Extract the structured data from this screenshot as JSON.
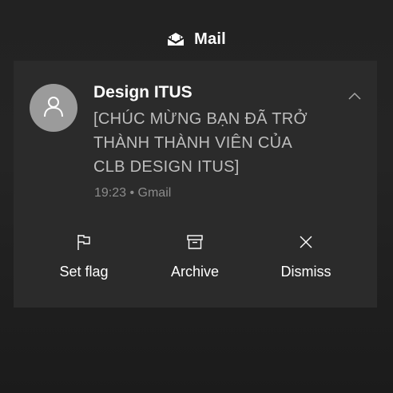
{
  "app": {
    "name": "Mail",
    "icon": "mail-envelope-icon"
  },
  "notification": {
    "sender": "Design ITUS",
    "subject_lines": [
      "[CHÚC MỪNG BẠN ĐÃ TRỞ",
      "THÀNH THÀNH VIÊN CỦA",
      "CLB DESIGN ITUS]"
    ],
    "meta": "19:23 • Gmail",
    "avatar_icon": "person-icon",
    "collapse_icon": "chevron-up-icon"
  },
  "actions": [
    {
      "label": "Set flag",
      "icon": "flag-icon"
    },
    {
      "label": "Archive",
      "icon": "archive-icon"
    },
    {
      "label": "Dismiss",
      "icon": "close-icon"
    }
  ],
  "colors": {
    "background": "#222222",
    "card": "#2b2b2b",
    "avatar": "#9b9b9b",
    "subject_text": "#bdbdbd",
    "meta_text": "#8c8c8c"
  }
}
